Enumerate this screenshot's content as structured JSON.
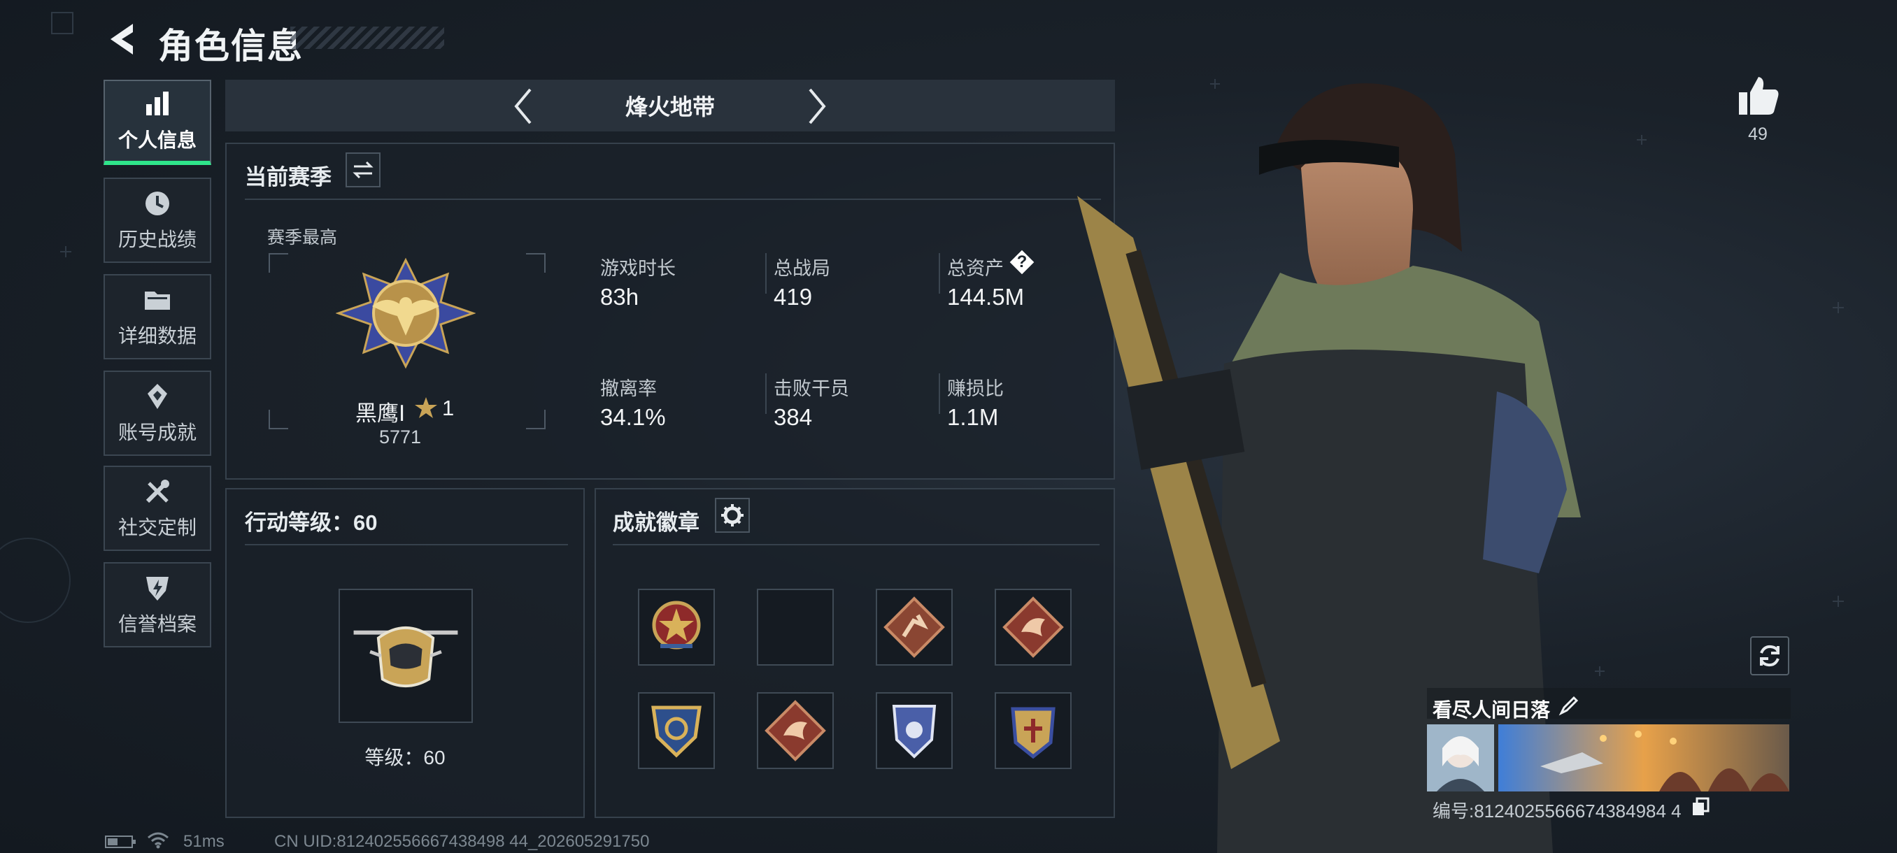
{
  "header": {
    "title": "角色信息"
  },
  "sidebar": {
    "items": [
      {
        "label": "个人信息",
        "icon": "bar-chart-icon",
        "active": true
      },
      {
        "label": "历史战绩",
        "icon": "history-clock-icon",
        "active": false
      },
      {
        "label": "详细数据",
        "icon": "folder-icon",
        "active": false
      },
      {
        "label": "账号成就",
        "icon": "achievement-icon",
        "active": false
      },
      {
        "label": "社交定制",
        "icon": "tools-icon",
        "active": false
      },
      {
        "label": "信誉档案",
        "icon": "shield-bolt-icon",
        "active": false
      }
    ]
  },
  "map_switch": {
    "current": "烽火地带"
  },
  "season": {
    "title": "当前赛季",
    "best_label": "赛季最高",
    "rank_name": "黑鹰Ⅰ",
    "rank_stars": "1",
    "rank_points": "5771",
    "stats": [
      {
        "label": "游戏时长",
        "value": "83h"
      },
      {
        "label": "总战局",
        "value": "419"
      },
      {
        "label": "总资产",
        "value": "144.5M"
      },
      {
        "label": "撤离率",
        "value": "34.1%"
      },
      {
        "label": "击败干员",
        "value": "384"
      },
      {
        "label": "赚损比",
        "value": "1.1M"
      }
    ],
    "help_mark": "?"
  },
  "action_level": {
    "title": "行动等级：60",
    "level_text": "等级：60"
  },
  "badges": {
    "title": "成就徽章",
    "slots": [
      {
        "icon": "star-medal-badge-icon"
      },
      {
        "icon": "empty-slot"
      },
      {
        "icon": "runner-diamond-badge-icon"
      },
      {
        "icon": "dragon-diamond-badge-icon"
      },
      {
        "icon": "eagle-shield-badge-icon"
      },
      {
        "icon": "dragon-diamond-badge-icon"
      },
      {
        "icon": "blue-shield-badge-icon"
      },
      {
        "icon": "gold-crest-badge-icon"
      }
    ]
  },
  "profile": {
    "likes": "49",
    "nickname": "看尽人间日落",
    "id_line": "编号:8124025566674384984 4",
    "id_text": "编号:812402556667438498 44"
  },
  "status_bar": {
    "ping": "51ms",
    "build_uid": "CN UID:812402556667438498 44_202605291750"
  },
  "colors": {
    "accent": "#2fe58a",
    "panel_border": "#36414c",
    "background": "#1a2129"
  }
}
